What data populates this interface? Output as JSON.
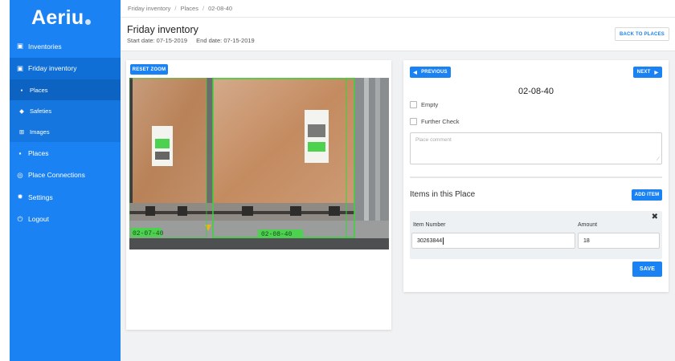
{
  "app": {
    "logo": "Aeriu"
  },
  "sidebar": {
    "items": [
      {
        "label": "Inventories",
        "icon": "boxes-icon"
      },
      {
        "label": "Friday inventory",
        "icon": "boxes-icon"
      },
      {
        "label": "Places",
        "icon": "box-icon"
      },
      {
        "label": "Place Connections",
        "icon": "connections-icon"
      },
      {
        "label": "Settings",
        "icon": "gear-icon"
      },
      {
        "label": "Logout",
        "icon": "power-icon"
      }
    ],
    "sub_items": [
      {
        "label": "Places",
        "icon": "box-icon"
      },
      {
        "label": "Safeties",
        "icon": "shield-icon"
      },
      {
        "label": "Images",
        "icon": "image-icon"
      }
    ]
  },
  "breadcrumb": [
    "Friday inventory",
    "Places",
    "02-08-40"
  ],
  "header": {
    "title": "Friday inventory",
    "start_date": "Start date: 07-15-2019",
    "end_date": "End date: 07-15-2019",
    "back_label": "BACK TO PLACES"
  },
  "image_panel": {
    "reset_label": "RESET ZOOM",
    "labels": [
      "02-07-40",
      "02-08-40"
    ]
  },
  "detail": {
    "prev_label": "PREVIOUS",
    "next_label": "NEXT",
    "place_id": "02-08-40",
    "empty_label": "Empty",
    "further_label": "Further Check",
    "comment_placeholder": "Place comment",
    "items_title": "Items in this Place",
    "add_item_label": "ADD ITEM",
    "item_number_label": "Item Number",
    "amount_label": "Amount",
    "item_number_value": "30263844",
    "amount_value": "18",
    "save_label": "SAVE"
  },
  "colors": {
    "accent": "#1a82f2",
    "detection_box": "#39d43b"
  }
}
